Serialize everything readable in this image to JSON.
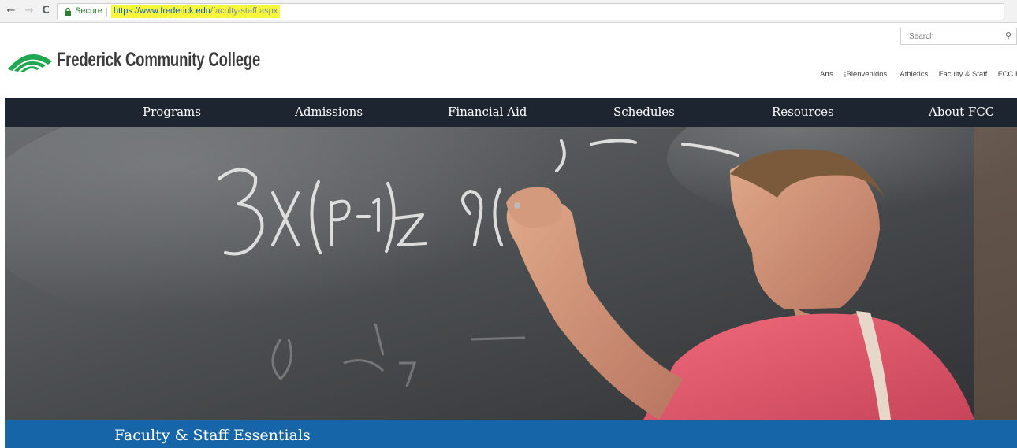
{
  "browser": {
    "back_glyph": "←",
    "forward_glyph": "→",
    "reload_glyph": "C",
    "security_label": "Secure",
    "separator": "|",
    "url_domain": "https://www.frederick.edu",
    "url_path": "/faculty-staff.aspx"
  },
  "header": {
    "logo_text": "Frederick Community College",
    "search_placeholder": "Search",
    "utility_links": [
      "Arts",
      "¡Bienvenidos!",
      "Athletics",
      "Faculty & Staff",
      "FCC Foundation"
    ]
  },
  "nav": {
    "items": [
      "Programs",
      "Admissions",
      "Financial Aid",
      "Schedules",
      "Resources",
      "About FCC"
    ]
  },
  "hero": {
    "image_alt": "Instructor writing math on a chalkboard",
    "chalk_text": "3X(P-1)Z 9("
  },
  "banner": {
    "title": "Faculty & Staff Essentials"
  },
  "colors": {
    "nav_bg": "#1d2530",
    "banner_bg": "#1565a8",
    "logo_green": "#1fa84f",
    "url_highlight": "#f7f73b"
  }
}
